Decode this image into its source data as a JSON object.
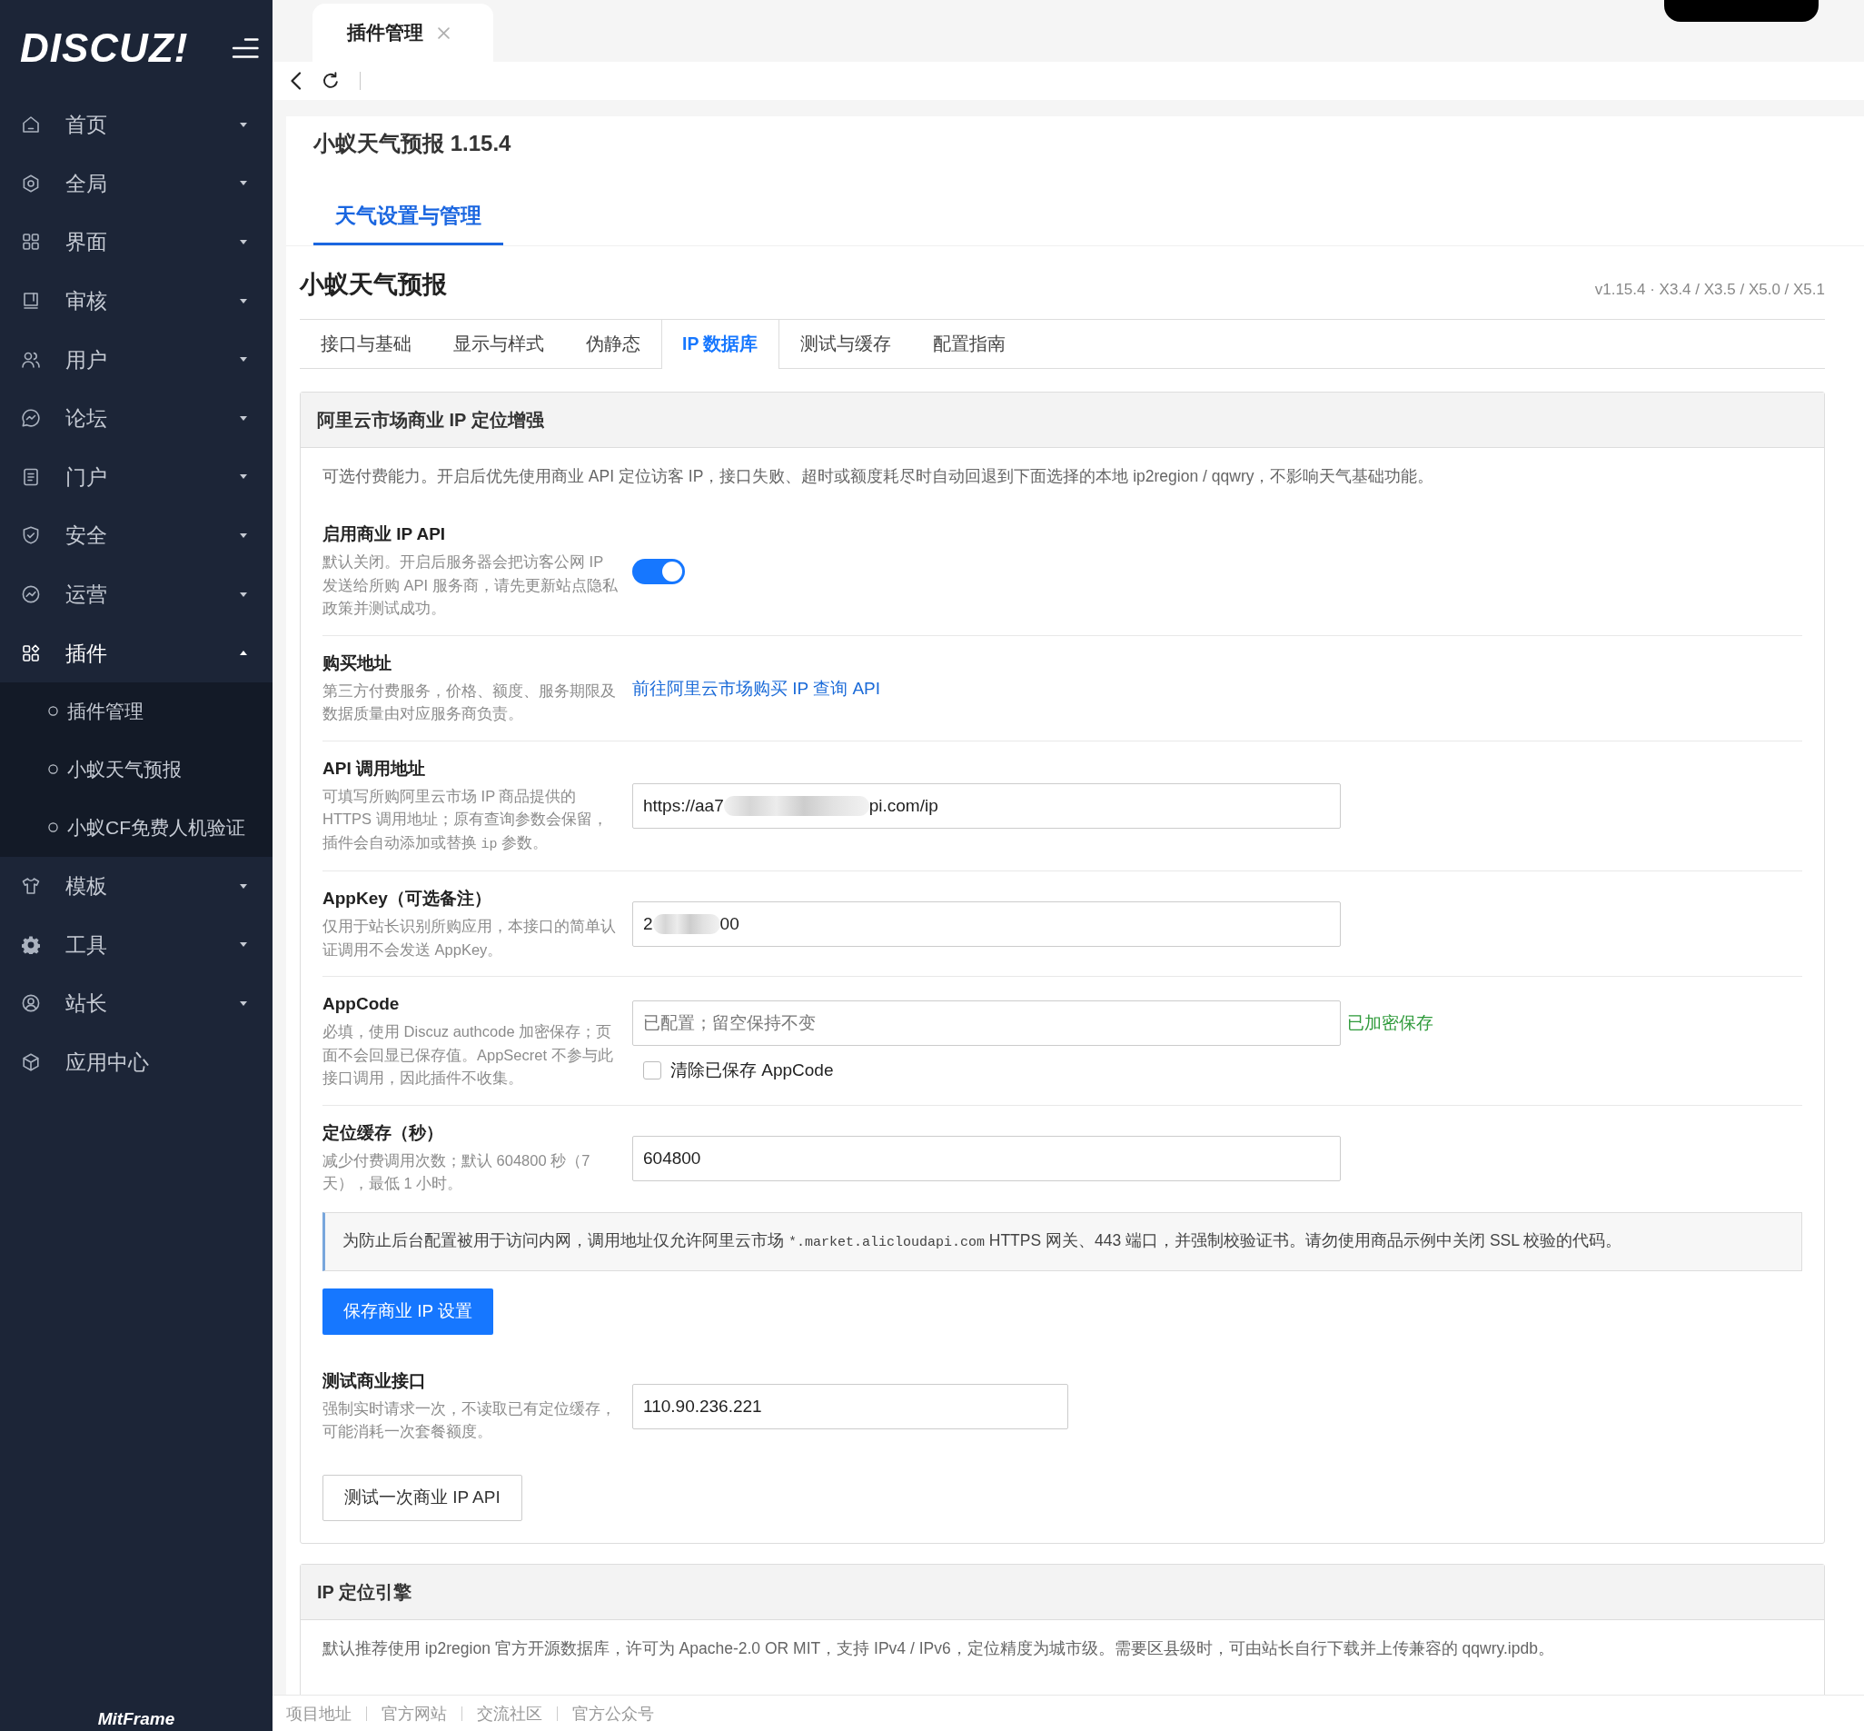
{
  "sidebar": {
    "logo": "DISCUZ!",
    "items": [
      {
        "label": "首页",
        "expanded": false,
        "selected": false
      },
      {
        "label": "全局",
        "expanded": false,
        "selected": false
      },
      {
        "label": "界面",
        "expanded": false,
        "selected": false
      },
      {
        "label": "审核",
        "expanded": false,
        "selected": false
      },
      {
        "label": "用户",
        "expanded": false,
        "selected": false
      },
      {
        "label": "论坛",
        "expanded": false,
        "selected": false
      },
      {
        "label": "门户",
        "expanded": false,
        "selected": false
      },
      {
        "label": "安全",
        "expanded": false,
        "selected": false
      },
      {
        "label": "运营",
        "expanded": false,
        "selected": false
      },
      {
        "label": "插件",
        "expanded": true,
        "selected": false,
        "children": [
          {
            "label": "插件管理",
            "selected": false
          },
          {
            "label": "小蚁天气预报",
            "selected": false
          },
          {
            "label": "小蚁CF免费人机验证",
            "selected": false
          }
        ]
      },
      {
        "label": "模板",
        "expanded": false,
        "selected": false
      },
      {
        "label": "工具",
        "expanded": false,
        "selected": false
      },
      {
        "label": "站长",
        "expanded": false,
        "selected": false
      },
      {
        "label": "应用中心",
        "selected": false
      }
    ],
    "brand": "MitFrame"
  },
  "page_tabs": [
    {
      "label": "插件管理",
      "selected": true
    }
  ],
  "plugin_header": {
    "title": "小蚁天气预报 1.15.4",
    "tabs": [
      {
        "label": "天气设置与管理",
        "selected": true
      }
    ]
  },
  "content": {
    "heading": "小蚁天气预报",
    "version": "v1.15.4 · X3.4 / X3.5 / X5.0 / X5.1",
    "tabs": [
      {
        "label": "接口与基础",
        "selected": false
      },
      {
        "label": "显示与样式",
        "selected": false
      },
      {
        "label": "伪静态",
        "selected": false
      },
      {
        "label": "IP 数据库",
        "selected": true
      },
      {
        "label": "测试与缓存",
        "selected": false
      },
      {
        "label": "配置指南",
        "selected": false
      }
    ]
  },
  "sections": [
    {
      "title": "阿里云市场商业 IP 定位增强",
      "intro": "可选付费能力。开启后优先使用商业 API 定位访客 IP，接口失败、超时或额度耗尽时自动回退到下面选择的本地 ip2region / qqwry，不影响天气基础功能。",
      "fields": [
        {
          "kind": "toggle",
          "label": "启用商业 IP API",
          "desc": [
            {
              "kind": "text",
              "text": "默认关闭。开启后服务器会把访客公网 IP 发送给所购 API 服务商，请先更新站点隐私政策并测试成功。"
            }
          ],
          "on": true
        },
        {
          "kind": "link",
          "label": "购买地址",
          "desc": [
            {
              "kind": "text",
              "text": "第三方付费服务，价格、额度、服务期限及数据质量由对应服务商负责。"
            }
          ],
          "link": "前往阿里云市场购买 IP 查询 API"
        },
        {
          "kind": "redacted_input",
          "label": "API 调用地址",
          "desc": [
            {
              "kind": "text",
              "text": "可填写所购阿里云市场 IP 商品提供的 HTTPS 调用地址；原有查询参数会保留，插件会自动添加或替换 "
            },
            {
              "kind": "code",
              "text": "ip"
            },
            {
              "kind": "text",
              "text": " 参数。"
            }
          ],
          "value_start": "https://aa7",
          "value_end": "pi.com/ip"
        },
        {
          "kind": "redacted_input",
          "label": "AppKey（可选备注）",
          "desc": [
            {
              "kind": "text",
              "text": "仅用于站长识别所购应用，本接口的简单认证调用不会发送 AppKey。"
            }
          ],
          "value_start": "2",
          "value_end": "00"
        },
        {
          "kind": "secret",
          "label": "AppCode",
          "desc": [
            {
              "kind": "text",
              "text": "必填，使用 Discuz authcode 加密保存；页面不会回显已保存值。AppSecret 不参与此接口调用，因此插件不收集。"
            }
          ],
          "placeholder": "已配置；留空保持不变",
          "status": "已加密保存",
          "checkbox": {
            "label": "清除已保存 AppCode",
            "checked": false
          }
        },
        {
          "kind": "input",
          "label": "定位缓存（秒）",
          "desc": [
            {
              "kind": "text",
              "text": "减少付费调用次数；默认 604800 秒（7 天），最低 1 小时。"
            }
          ],
          "value": "604800"
        }
      ],
      "notice": [
        {
          "kind": "text",
          "text": "为防止后台配置被用于访问内网，调用地址仅允许阿里云市场 "
        },
        {
          "kind": "code",
          "text": "*.market.alicloudapi.com"
        },
        {
          "kind": "text",
          "text": " HTTPS 网关、443 端口，并强制校验证书。请勿使用商品示例中关闭 SSL 校验的代码。"
        }
      ],
      "save_button": "保存商业 IP 设置",
      "test": {
        "label": "测试商业接口",
        "desc": "强制实时请求一次，不读取已有定位缓存，可能消耗一次套餐额度。",
        "value": "110.90.236.221"
      },
      "test_button": "测试一次商业 IP API"
    },
    {
      "title": "IP 定位引擎",
      "intro": "默认推荐使用 ip2region 官方开源数据库，许可为 Apache-2.0 OR MIT，支持 IPv4 / IPv6，定位精度为城市级。需要区县级时，可由站长自行下载并上传兼容的 qqwry.ipdb。"
    }
  ],
  "footer_links": [
    "项目地址",
    "官方网站",
    "交流社区",
    "官方公众号"
  ]
}
